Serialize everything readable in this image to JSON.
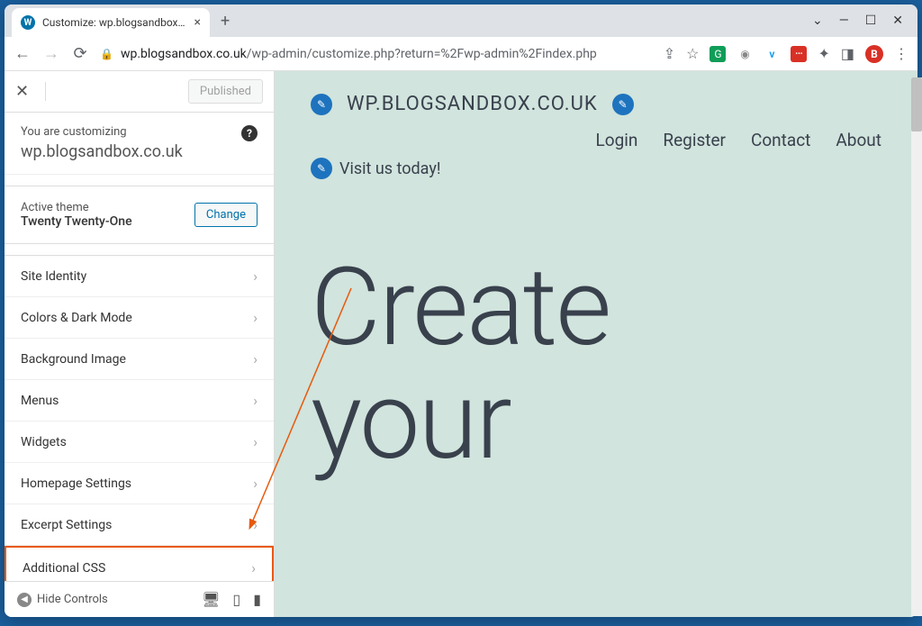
{
  "browser": {
    "tab_title": "Customize: wp.blogsandbox.co...",
    "url_prefix": "wp.blogsandbox.co.uk",
    "url_path": "/wp-admin/customize.php?return=%2Fwp-admin%2Findex.php"
  },
  "customizer": {
    "published_label": "Published",
    "customizing_label": "You are customizing",
    "site_name": "wp.blogsandbox.co.uk",
    "active_theme_label": "Active theme",
    "theme_name": "Twenty Twenty-One",
    "change_label": "Change",
    "hide_controls_label": "Hide Controls",
    "items": [
      "Site Identity",
      "Colors & Dark Mode",
      "Background Image",
      "Menus",
      "Widgets",
      "Homepage Settings",
      "Excerpt Settings",
      "Additional CSS"
    ]
  },
  "preview": {
    "site_title": "WP.BLOGSANDBOX.CO.UK",
    "tagline": "Visit us today!",
    "nav": [
      "Login",
      "Register",
      "Contact",
      "About"
    ],
    "hero_line1": "Create",
    "hero_line2": "your"
  }
}
